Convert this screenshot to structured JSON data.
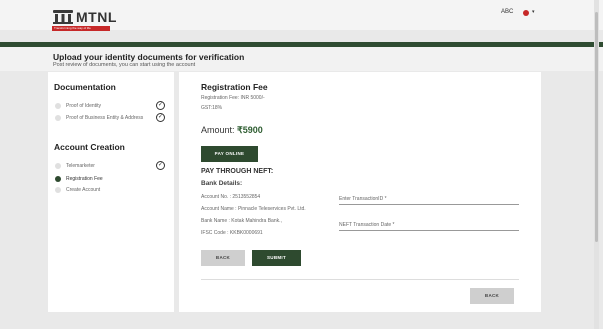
{
  "header": {
    "logo_text": "MTNL",
    "logo_tagline": "Transforming the way of life",
    "user_name": "ABC",
    "caret": "▾"
  },
  "page": {
    "title": "Upload your identity documents for verification",
    "subtitle": "Post review of documents, you can start using the account"
  },
  "sidebar": {
    "documentation_title": "Documentation",
    "documentation_steps": [
      {
        "label": "Proof of Identity",
        "done": true
      },
      {
        "label": "Proof of Business Entity & Address",
        "done": true
      }
    ],
    "account_title": "Account Creation",
    "account_steps": [
      {
        "label": "Telemarketer",
        "done": true
      },
      {
        "label": "Registration Fee",
        "active": true
      },
      {
        "label": "Create Account"
      }
    ],
    "check_glyph": "✓"
  },
  "fee": {
    "title": "Registration Fee",
    "fee_line": "Registration Fee: INR 5000/-",
    "gst_line": "GST:18%",
    "amount_label": "Amount:",
    "amount_value": "₹5900",
    "pay_online_label": "PAY ONLINE",
    "neft_title": "PAY THROUGH NEFT:",
    "bank_details_title": "Bank Details:",
    "account_no": "Account No. : 2513552854",
    "account_name": "Account Name : Pinnacle Teleservices Pvt. Ltd.",
    "bank_name": "Bank Name : Kotak Mahindra Bank.,",
    "ifsc": "IFSC Code : KKBK0000691",
    "transaction_id_placeholder": "Enter TransactionID *",
    "transaction_date_placeholder": "NEFT Transaction Date *",
    "back_label": "BACK",
    "submit_label": "SUBMIT",
    "bottom_back_label": "BACK"
  },
  "colors": {
    "brand_green": "#2e4a2f",
    "brand_red": "#c62828"
  }
}
